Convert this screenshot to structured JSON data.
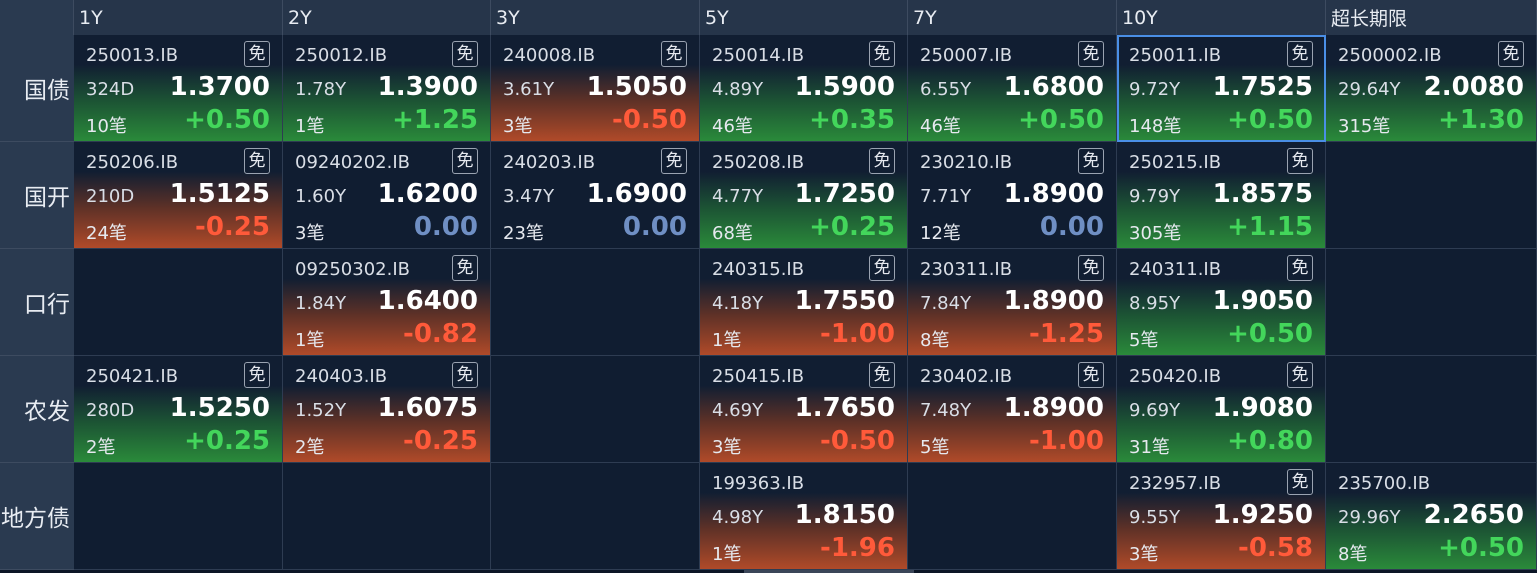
{
  "columns": [
    "1Y",
    "2Y",
    "3Y",
    "5Y",
    "7Y",
    "10Y",
    "超长期限"
  ],
  "rows": [
    {
      "label": "国债",
      "cells": [
        {
          "code": "250013.IB",
          "badge": "免",
          "term": "324D",
          "yield": "1.3700",
          "count": "10笔",
          "change": "+0.50",
          "trend": "up"
        },
        {
          "code": "250012.IB",
          "badge": "免",
          "term": "1.78Y",
          "yield": "1.3900",
          "count": "1笔",
          "change": "+1.25",
          "trend": "up"
        },
        {
          "code": "240008.IB",
          "badge": "免",
          "term": "3.61Y",
          "yield": "1.5050",
          "count": "3笔",
          "change": "-0.50",
          "trend": "down"
        },
        {
          "code": "250014.IB",
          "badge": "免",
          "term": "4.89Y",
          "yield": "1.5900",
          "count": "46笔",
          "change": "+0.35",
          "trend": "up"
        },
        {
          "code": "250007.IB",
          "badge": "免",
          "term": "6.55Y",
          "yield": "1.6800",
          "count": "46笔",
          "change": "+0.50",
          "trend": "up"
        },
        {
          "code": "250011.IB",
          "badge": "免",
          "term": "9.72Y",
          "yield": "1.7525",
          "count": "148笔",
          "change": "+0.50",
          "trend": "up",
          "selected": true
        },
        {
          "code": "2500002.IB",
          "badge": "免",
          "term": "29.64Y",
          "yield": "2.0080",
          "count": "315笔",
          "change": "+1.30",
          "trend": "up"
        }
      ]
    },
    {
      "label": "国开",
      "cells": [
        {
          "code": "250206.IB",
          "badge": "免",
          "term": "210D",
          "yield": "1.5125",
          "count": "24笔",
          "change": "-0.25",
          "trend": "down"
        },
        {
          "code": "09240202.IB",
          "badge": "免",
          "term": "1.60Y",
          "yield": "1.6200",
          "count": "3笔",
          "change": "0.00",
          "trend": "flat"
        },
        {
          "code": "240203.IB",
          "badge": "免",
          "term": "3.47Y",
          "yield": "1.6900",
          "count": "23笔",
          "change": "0.00",
          "trend": "flat"
        },
        {
          "code": "250208.IB",
          "badge": "免",
          "term": "4.77Y",
          "yield": "1.7250",
          "count": "68笔",
          "change": "+0.25",
          "trend": "up"
        },
        {
          "code": "230210.IB",
          "badge": "免",
          "term": "7.71Y",
          "yield": "1.8900",
          "count": "12笔",
          "change": "0.00",
          "trend": "flat"
        },
        {
          "code": "250215.IB",
          "badge": "免",
          "term": "9.79Y",
          "yield": "1.8575",
          "count": "305笔",
          "change": "+1.15",
          "trend": "up"
        },
        null
      ]
    },
    {
      "label": "口行",
      "cells": [
        null,
        {
          "code": "09250302.IB",
          "badge": "免",
          "term": "1.84Y",
          "yield": "1.6400",
          "count": "1笔",
          "change": "-0.82",
          "trend": "down"
        },
        null,
        {
          "code": "240315.IB",
          "badge": "免",
          "term": "4.18Y",
          "yield": "1.7550",
          "count": "1笔",
          "change": "-1.00",
          "trend": "down"
        },
        {
          "code": "230311.IB",
          "badge": "免",
          "term": "7.84Y",
          "yield": "1.8900",
          "count": "8笔",
          "change": "-1.25",
          "trend": "down"
        },
        {
          "code": "240311.IB",
          "badge": "免",
          "term": "8.95Y",
          "yield": "1.9050",
          "count": "5笔",
          "change": "+0.50",
          "trend": "up"
        },
        null
      ]
    },
    {
      "label": "农发",
      "cells": [
        {
          "code": "250421.IB",
          "badge": "免",
          "term": "280D",
          "yield": "1.5250",
          "count": "2笔",
          "change": "+0.25",
          "trend": "up"
        },
        {
          "code": "240403.IB",
          "badge": "免",
          "term": "1.52Y",
          "yield": "1.6075",
          "count": "2笔",
          "change": "-0.25",
          "trend": "down"
        },
        null,
        {
          "code": "250415.IB",
          "badge": "免",
          "term": "4.69Y",
          "yield": "1.7650",
          "count": "3笔",
          "change": "-0.50",
          "trend": "down"
        },
        {
          "code": "230402.IB",
          "badge": "免",
          "term": "7.48Y",
          "yield": "1.8900",
          "count": "5笔",
          "change": "-1.00",
          "trend": "down"
        },
        {
          "code": "250420.IB",
          "badge": "免",
          "term": "9.69Y",
          "yield": "1.9080",
          "count": "31笔",
          "change": "+0.80",
          "trend": "up"
        },
        null
      ]
    },
    {
      "label": "地方债",
      "cells": [
        null,
        null,
        null,
        {
          "code": "199363.IB",
          "badge": "",
          "term": "4.98Y",
          "yield": "1.8150",
          "count": "1笔",
          "change": "-1.96",
          "trend": "down"
        },
        null,
        {
          "code": "232957.IB",
          "badge": "免",
          "term": "9.55Y",
          "yield": "1.9250",
          "count": "3笔",
          "change": "-0.58",
          "trend": "down"
        },
        {
          "code": "235700.IB",
          "badge": "",
          "term": "29.96Y",
          "yield": "2.2650",
          "count": "8笔",
          "change": "+0.50",
          "trend": "up"
        }
      ]
    }
  ],
  "colors": {
    "up": "#43d65b",
    "down": "#ff5a3a",
    "flat": "#6f8fc4",
    "selection": "#4a8fe6"
  }
}
